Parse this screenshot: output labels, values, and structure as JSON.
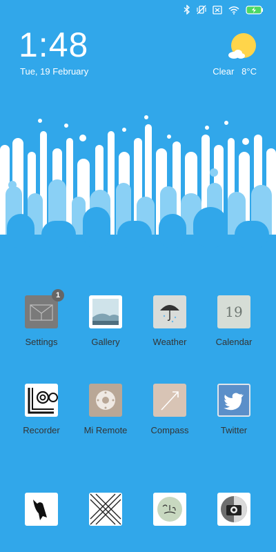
{
  "status_bar": {
    "icons": [
      "bluetooth-icon",
      "vibrate-off-icon",
      "sim-off-icon",
      "wifi-icon",
      "battery-charging-icon"
    ]
  },
  "lockscreen_clock": {
    "time": "1:48",
    "date": "Tue, 19 February"
  },
  "weather_widget": {
    "condition": "Clear",
    "temperature": "8°C",
    "icon": "sun-cloud-icon"
  },
  "colors": {
    "background": "#31a7ea",
    "wallpaper_white": "#ffffff",
    "wallpaper_light": "#8ad0f5",
    "badge": "#666666",
    "label_text": "#333333"
  },
  "apps": [
    {
      "label": "Settings",
      "badge": "1",
      "icon": "settings-icon"
    },
    {
      "label": "Gallery",
      "icon": "gallery-icon"
    },
    {
      "label": "Weather",
      "icon": "weather-umbrella-icon"
    },
    {
      "label": "Calendar",
      "day": "19",
      "icon": "calendar-icon"
    },
    {
      "label": "Recorder",
      "icon": "recorder-icon"
    },
    {
      "label": "Mi Remote",
      "icon": "remote-icon"
    },
    {
      "label": "Compass",
      "icon": "compass-icon"
    },
    {
      "label": "Twitter",
      "icon": "twitter-icon"
    }
  ],
  "dock": [
    {
      "icon": "bird-app-icon"
    },
    {
      "icon": "x-pattern-app-icon"
    },
    {
      "icon": "cest-la-vie-app-icon"
    },
    {
      "icon": "camera-app-icon"
    }
  ]
}
